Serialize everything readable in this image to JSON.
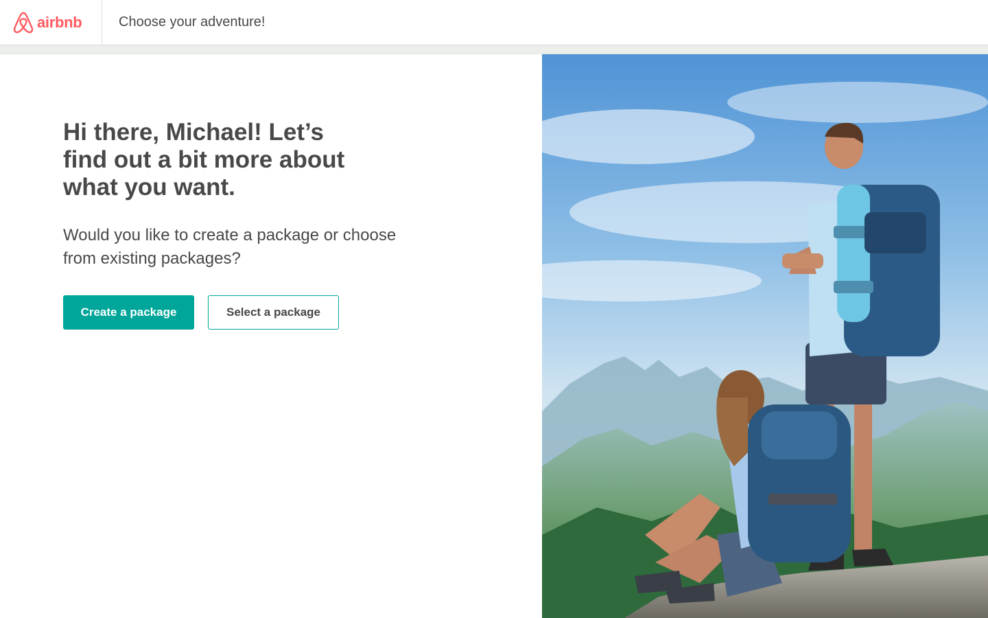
{
  "header": {
    "logo_text": "airbnb",
    "logo_icon": "airbnb-belo-icon",
    "title": "Choose your adventure!"
  },
  "main": {
    "heading": "Hi there, Michael! Let’s find out a bit more about what you want.",
    "question": "Would you like to create a package or choose from existing packages?",
    "primary_button": "Create a package",
    "secondary_button": "Select a package"
  },
  "hero": {
    "description": "hikers-on-mountain-photo"
  },
  "colors": {
    "brand": "#ff5a5f",
    "accent": "#00a699",
    "text": "#484848"
  }
}
